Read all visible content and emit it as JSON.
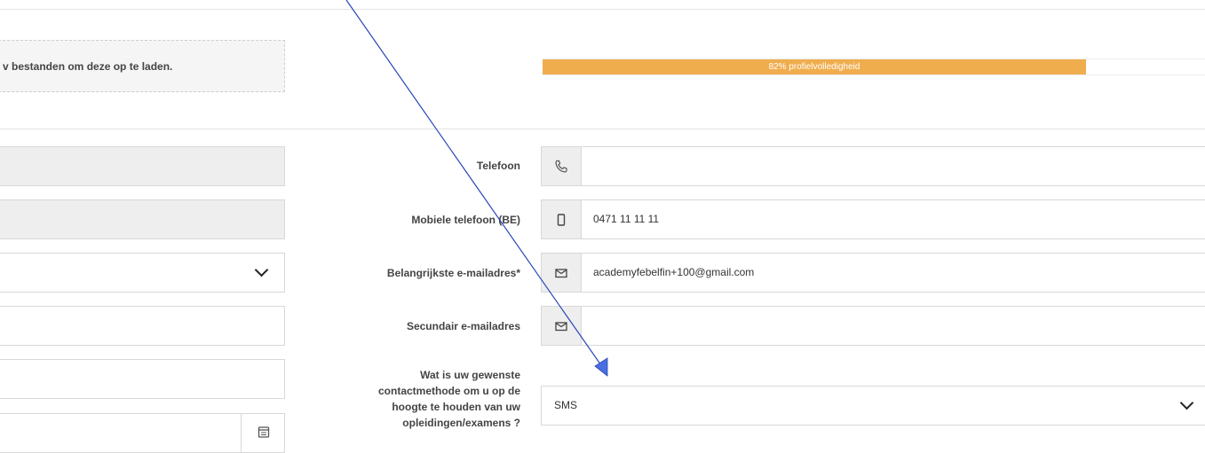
{
  "upload": {
    "text": "v bestanden om deze op te laden."
  },
  "profile": {
    "completeness": 82,
    "label": "82% profielvolledigheid"
  },
  "left_fields": [
    {
      "value": "",
      "kind": "disabled"
    },
    {
      "value": "",
      "kind": "disabled"
    },
    {
      "value": "",
      "kind": "select"
    },
    {
      "value": "",
      "kind": "text"
    },
    {
      "value": "",
      "kind": "text"
    },
    {
      "value": "",
      "kind": "date"
    }
  ],
  "contact": {
    "phone_label": "Telefoon",
    "phone_value": "",
    "mobile_label": "Mobiele telefoon (BE)",
    "mobile_value": "0471 11 11 11",
    "email_label": "Belangrijkste e-mailadres*",
    "email_value": "academyfebelfin+100@gmail.com",
    "secondary_email_label": "Secundair e-mailadres",
    "secondary_email_value": "",
    "method_label": "Wat is uw gewenste contactmethode om u op de hoogte te houden van uw opleidingen/examens ?",
    "method_value": "SMS"
  },
  "icons": {
    "phone": "phone-icon",
    "mobile": "mobile-icon",
    "email": "envelope-icon",
    "calendar": "calendar-icon",
    "select": "chevron-down-icon"
  },
  "colors": {
    "progress": "#f0ad4e",
    "annotation_arrow": "#2a45b8",
    "disabled_bg": "#eeeeee",
    "border": "#d8d8d8"
  }
}
